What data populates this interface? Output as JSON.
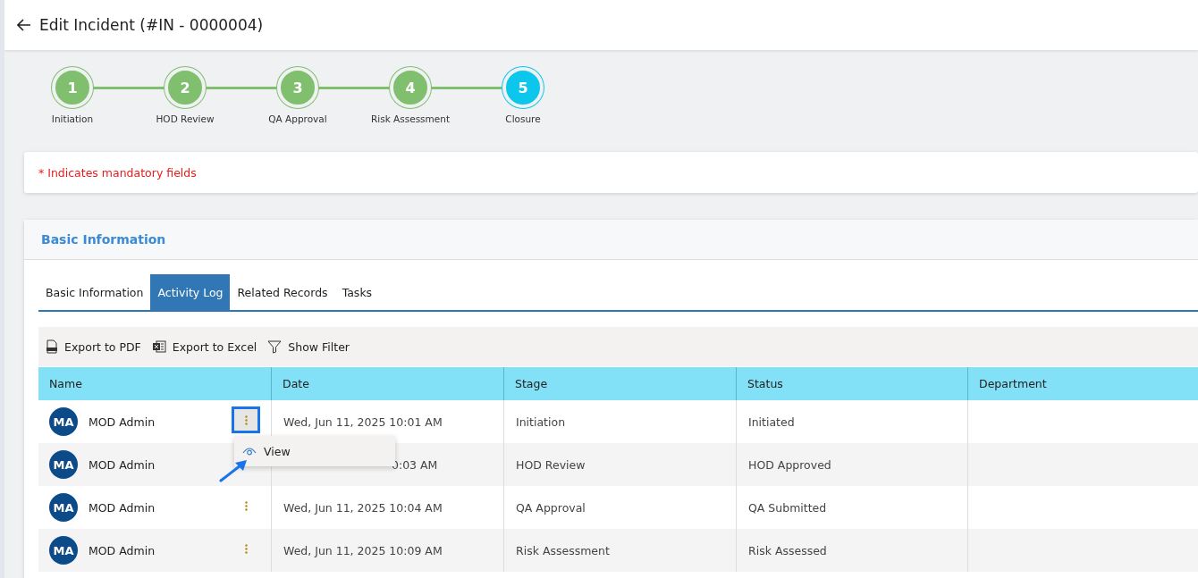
{
  "header": {
    "title": "Edit Incident (#IN - 0000004)"
  },
  "steps": [
    {
      "number": "1",
      "label": "Initiation",
      "current": false
    },
    {
      "number": "2",
      "label": "HOD Review",
      "current": false
    },
    {
      "number": "3",
      "label": "QA Approval",
      "current": false
    },
    {
      "number": "4",
      "label": "Risk Assessment",
      "current": false
    },
    {
      "number": "5",
      "label": "Closure",
      "current": true
    }
  ],
  "notice": "* Indicates mandatory fields",
  "section": {
    "title": "Basic Information"
  },
  "tabs": [
    {
      "label": "Basic Information",
      "selected": false
    },
    {
      "label": "Activity Log",
      "selected": true
    },
    {
      "label": "Related Records",
      "selected": false
    },
    {
      "label": "Tasks",
      "selected": false
    }
  ],
  "toolbar": [
    {
      "kind": "pdf",
      "label": "Export to PDF"
    },
    {
      "kind": "excel",
      "label": "Export to Excel"
    },
    {
      "kind": "filter",
      "label": "Show Filter"
    }
  ],
  "table": {
    "columns": [
      "Name",
      "Date",
      "Stage",
      "Status",
      "Department"
    ],
    "rows": [
      {
        "initials": "MA",
        "name": "MOD Admin",
        "menu_highlighted": true,
        "menu_covered": false,
        "date": "Wed, Jun 11, 2025 10:01 AM",
        "date_covered": false,
        "stage": "Initiation",
        "status": "Initiated"
      },
      {
        "initials": "MA",
        "name": "MOD Admin",
        "menu_covered": true,
        "date": "0:03 AM",
        "date_covered": true,
        "stage": "HOD Review",
        "status": "HOD Approved"
      },
      {
        "initials": "MA",
        "name": "MOD Admin",
        "menu_highlighted": false,
        "menu_covered": false,
        "date": "Wed, Jun 11, 2025 10:04 AM",
        "date_covered": false,
        "stage": "QA Approval",
        "status": "QA Submitted"
      },
      {
        "initials": "MA",
        "name": "MOD Admin",
        "menu_highlighted": false,
        "menu_covered": false,
        "date": "Wed, Jun 11, 2025 10:09 AM",
        "date_covered": false,
        "stage": "Risk Assessment",
        "status": "Risk Assessed"
      }
    ]
  },
  "row_menu": {
    "items": [
      {
        "label": "View"
      }
    ]
  }
}
